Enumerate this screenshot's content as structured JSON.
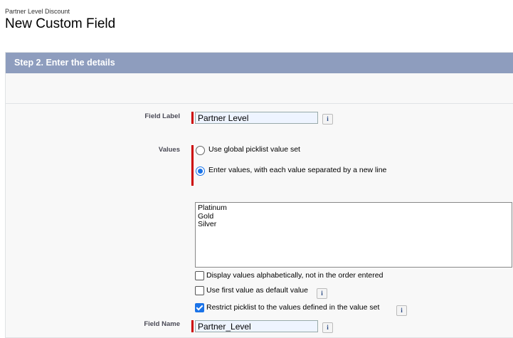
{
  "header": {
    "breadcrumb": "Partner Level Discount",
    "title": "New Custom Field"
  },
  "step": {
    "title": "Step 2. Enter the details"
  },
  "fields": {
    "field_label": {
      "label": "Field Label",
      "value": "Partner Level",
      "info": "i"
    },
    "values": {
      "label": "Values",
      "options": [
        {
          "label": "Use global picklist value set",
          "selected": false
        },
        {
          "label": "Enter values, with each value separated by a new line",
          "selected": true
        }
      ],
      "entries": [
        "Platinum",
        "Gold",
        "Silver"
      ]
    },
    "checkboxes": [
      {
        "label": "Display values alphabetically, not in the order entered",
        "checked": false
      },
      {
        "label": "Use first value as default value",
        "checked": false,
        "info": "i"
      },
      {
        "label": "Restrict picklist to the values defined in the value set",
        "checked": true,
        "info": "i"
      }
    ],
    "field_name": {
      "label": "Field Name",
      "value": "Partner_Level",
      "info": "i"
    }
  }
}
